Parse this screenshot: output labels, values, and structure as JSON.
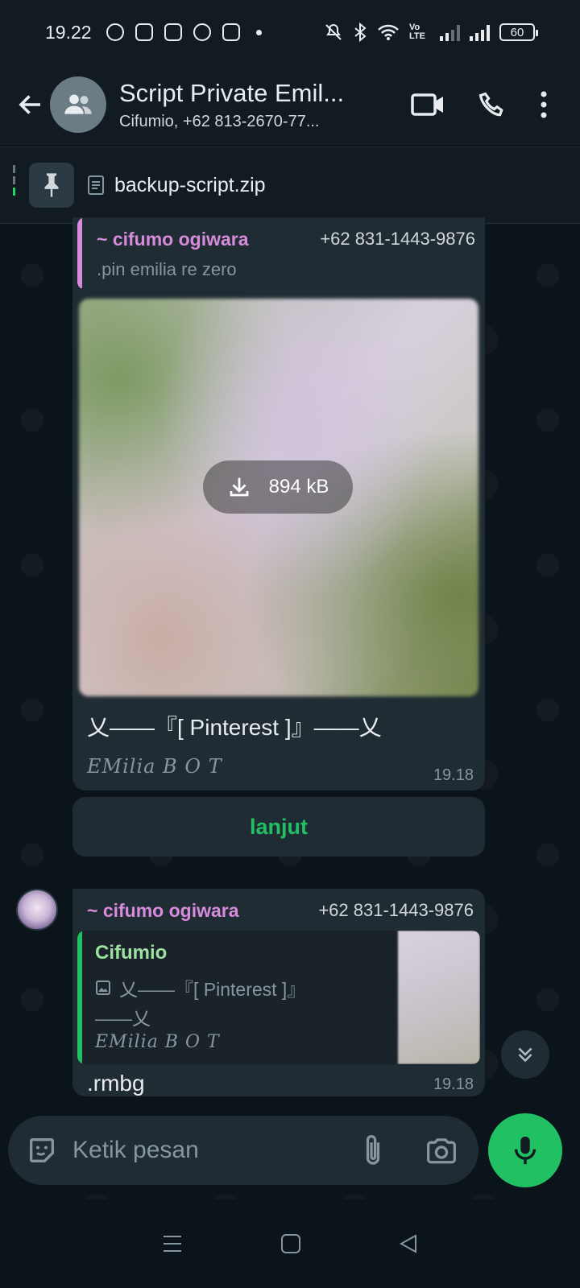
{
  "status_bar": {
    "time": "19.22",
    "battery": "60",
    "volte": "Vo LTE"
  },
  "header": {
    "title": "Script Private Emil...",
    "subtitle": "Cifumio, +62 813-2670-77..."
  },
  "pinned": {
    "file_name": "backup-script.zip"
  },
  "messages": [
    {
      "sender_name": "~ cifumo ogiwara",
      "sender_phone": "+62 831-1443-9876",
      "quoted_text": ".pin emilia re zero",
      "image_size": "894 kB",
      "caption": "乂——『[ Pinterest ]』——乂",
      "signature": "EMilia  B O T",
      "time": "19.18"
    },
    {
      "sender_name": "~ cifumo ogiwara",
      "sender_phone": "+62 831-1443-9876",
      "quote_author": "Cifumio",
      "quote_line1": "乂——『[ Pinterest ]』",
      "quote_line2": "——乂",
      "quote_signature": "EMilia  B O T",
      "text": ".rmbg",
      "time": "19.18"
    }
  ],
  "button": {
    "label": "lanjut"
  },
  "composer": {
    "placeholder": "Ketik pesan"
  },
  "colors": {
    "accent_green": "#21c063",
    "sender_purple": "#d88bdc",
    "bubble_bg": "#202c33",
    "app_bg": "#0b141a"
  }
}
